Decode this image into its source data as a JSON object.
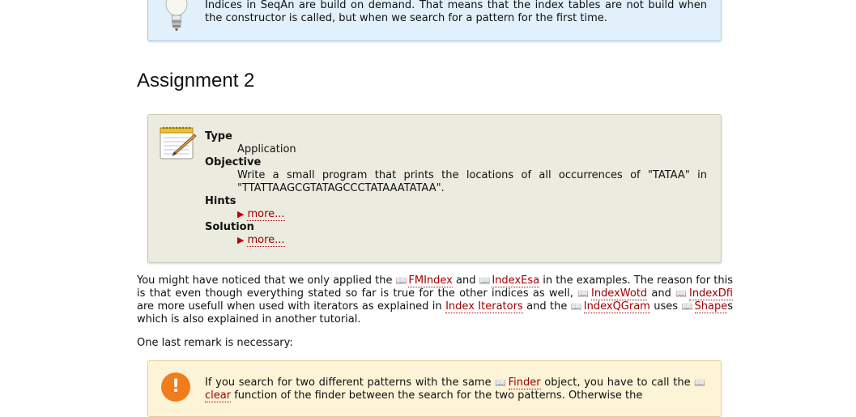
{
  "tip": {
    "text": "Indices in SeqAn are build on demand. That means that the index tables are not build when the constructor is called, but when we search for a pattern for the first time."
  },
  "section": {
    "title": "Assignment 2"
  },
  "assignment": {
    "type_label": "Type",
    "type_value": "Application",
    "objective_label": "Objective",
    "objective_value": "Write a small program that prints the locations of all occurrences of \"TATAA\" in \"TTATTAAGCGTATAGCCCTATAAATATAA\".",
    "hints_label": "Hints",
    "hints_more": "more...",
    "solution_label": "Solution",
    "solution_more": "more..."
  },
  "paragraph1": {
    "t1": "You might have noticed that we only applied the ",
    "link_fmindex": "FMIndex",
    "t2": " and ",
    "link_indexesa": "IndexEsa",
    "t3": " in the examples. The reason for this is that even though everything stated so far is true for the other indices as well, ",
    "link_indexwotd": "IndexWotd",
    "t4": " and ",
    "link_indexdfi": "IndexDfi",
    "t5": " are more usefull when used with iterators as explained in ",
    "link_indexiterators": "Index Iterators",
    "t6": " and the ",
    "link_indexqgram": "IndexQGram",
    "t7": " uses ",
    "link_shape": "Shape",
    "t8": "s which is also explained in another tutorial."
  },
  "paragraph2": {
    "text": "One last remark is necessary:"
  },
  "warning": {
    "t1": "If you search for two different patterns with the same ",
    "link_finder": "Finder",
    "t2": " object, you have to call the ",
    "link_clear": "clear",
    "t3": " function of the finder between the search for the two patterns. Otherwise the"
  }
}
